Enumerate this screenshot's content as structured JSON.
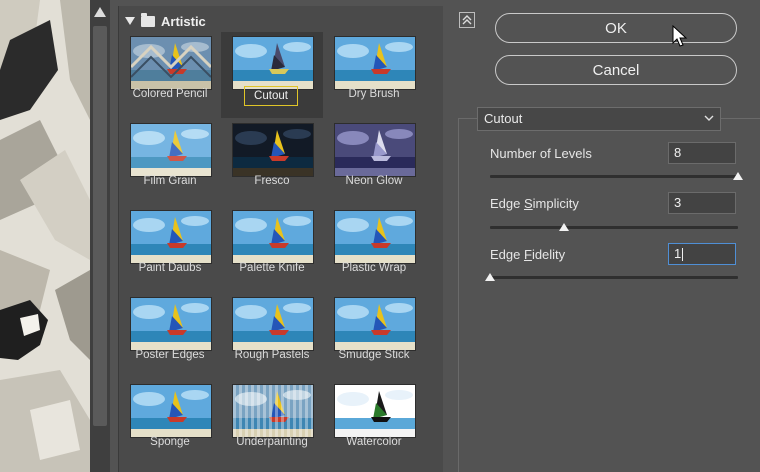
{
  "gallery": {
    "category": "Artistic",
    "filters": [
      {
        "label": "Colored Pencil",
        "selected": false
      },
      {
        "label": "Cutout",
        "selected": true
      },
      {
        "label": "Dry Brush",
        "selected": false
      },
      {
        "label": "Film Grain",
        "selected": false
      },
      {
        "label": "Fresco",
        "selected": false
      },
      {
        "label": "Neon Glow",
        "selected": false
      },
      {
        "label": "Paint Daubs",
        "selected": false
      },
      {
        "label": "Palette Knife",
        "selected": false
      },
      {
        "label": "Plastic Wrap",
        "selected": false
      },
      {
        "label": "Poster Edges",
        "selected": false
      },
      {
        "label": "Rough Pastels",
        "selected": false
      },
      {
        "label": "Smudge Stick",
        "selected": false
      },
      {
        "label": "Sponge",
        "selected": false
      },
      {
        "label": "Underpainting",
        "selected": false
      },
      {
        "label": "Watercolor",
        "selected": false
      }
    ]
  },
  "buttons": {
    "ok": "OK",
    "cancel": "Cancel"
  },
  "settings": {
    "filter_select": "Cutout",
    "params": [
      {
        "label_pre": "Number of Levels",
        "label_u": "",
        "label_post": "",
        "value": "8",
        "slider_fraction": 1.0
      },
      {
        "label_pre": "Edge ",
        "label_u": "S",
        "label_post": "implicity",
        "value": "3",
        "slider_fraction": 0.3
      },
      {
        "label_pre": "Edge ",
        "label_u": "F",
        "label_post": "idelity",
        "value": "1",
        "slider_fraction": 0.0
      }
    ]
  },
  "icons": {
    "category_expand": "triangle-down-icon",
    "category_folder": "folder-icon",
    "collapse": "collapse-up-icon",
    "select_chevron": "chevron-down-icon",
    "scroll_up": "arrow-up-icon",
    "cursor": "mouse-pointer-icon"
  },
  "colors": {
    "panel_bg": "#535353",
    "gallery_bg": "#4a4a4a",
    "selection_outline": "#e0c528",
    "focus_border": "#4f8fd6"
  }
}
